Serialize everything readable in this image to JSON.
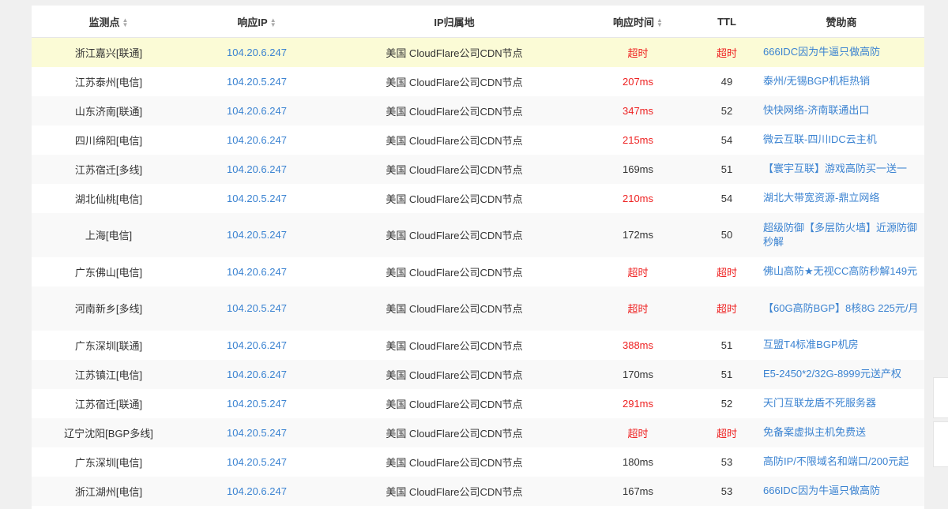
{
  "headers": {
    "location": "监测点",
    "ip": "响应IP",
    "geo": "IP归属地",
    "time": "响应时间",
    "ttl": "TTL",
    "sponsor": "赞助商"
  },
  "sort_icon": "sort-arrows-icon",
  "colors": {
    "link": "#3b83d1",
    "timeout": "#ee2222",
    "highlight": "#fbfbd6"
  },
  "rows": [
    {
      "location": "浙江嘉兴[联通]",
      "ip": "104.20.6.247",
      "geo": "美国 CloudFlare公司CDN节点",
      "time": "超时",
      "time_status": "red",
      "ttl": "超时",
      "ttl_status": "red",
      "sponsor": "666IDC因为牛逼只做高防",
      "highlight": true
    },
    {
      "location": "江苏泰州[电信]",
      "ip": "104.20.5.247",
      "geo": "美国 CloudFlare公司CDN节点",
      "time": "207ms",
      "time_status": "red",
      "ttl": "49",
      "ttl_status": "normal",
      "sponsor": "泰州/无锡BGP机柜热销"
    },
    {
      "location": "山东济南[联通]",
      "ip": "104.20.6.247",
      "geo": "美国 CloudFlare公司CDN节点",
      "time": "347ms",
      "time_status": "red",
      "ttl": "52",
      "ttl_status": "normal",
      "sponsor": "快快网络-济南联通出口"
    },
    {
      "location": "四川绵阳[电信]",
      "ip": "104.20.6.247",
      "geo": "美国 CloudFlare公司CDN节点",
      "time": "215ms",
      "time_status": "red",
      "ttl": "54",
      "ttl_status": "normal",
      "sponsor": "微云互联-四川IDC云主机"
    },
    {
      "location": "江苏宿迁[多线]",
      "ip": "104.20.6.247",
      "geo": "美国 CloudFlare公司CDN节点",
      "time": "169ms",
      "time_status": "normal",
      "ttl": "51",
      "ttl_status": "normal",
      "sponsor": "【寰宇互联】游戏高防买一送一"
    },
    {
      "location": "湖北仙桃[电信]",
      "ip": "104.20.5.247",
      "geo": "美国 CloudFlare公司CDN节点",
      "time": "210ms",
      "time_status": "red",
      "ttl": "54",
      "ttl_status": "normal",
      "sponsor": "湖北大带宽资源-鼎立网络"
    },
    {
      "location": "上海[电信]",
      "ip": "104.20.5.247",
      "geo": "美国 CloudFlare公司CDN节点",
      "time": "172ms",
      "time_status": "normal",
      "ttl": "50",
      "ttl_status": "normal",
      "sponsor": "超级防御【多层防火墙】近源防御秒解",
      "tall": true
    },
    {
      "location": "广东佛山[电信]",
      "ip": "104.20.6.247",
      "geo": "美国 CloudFlare公司CDN节点",
      "time": "超时",
      "time_status": "red",
      "ttl": "超时",
      "ttl_status": "red",
      "sponsor": "佛山高防★无视CC高防秒解149元"
    },
    {
      "location": "河南新乡[多线]",
      "ip": "104.20.5.247",
      "geo": "美国 CloudFlare公司CDN节点",
      "time": "超时",
      "time_status": "red",
      "ttl": "超时",
      "ttl_status": "red",
      "sponsor": "【60G高防BGP】8核8G 225元/月",
      "tall": true
    },
    {
      "location": "广东深圳[联通]",
      "ip": "104.20.6.247",
      "geo": "美国 CloudFlare公司CDN节点",
      "time": "388ms",
      "time_status": "red",
      "ttl": "51",
      "ttl_status": "normal",
      "sponsor": "互盟T4标准BGP机房"
    },
    {
      "location": "江苏镇江[电信]",
      "ip": "104.20.6.247",
      "geo": "美国 CloudFlare公司CDN节点",
      "time": "170ms",
      "time_status": "normal",
      "ttl": "51",
      "ttl_status": "normal",
      "sponsor": "E5-2450*2/32G-8999元送产权"
    },
    {
      "location": "江苏宿迁[联通]",
      "ip": "104.20.5.247",
      "geo": "美国 CloudFlare公司CDN节点",
      "time": "291ms",
      "time_status": "red",
      "ttl": "52",
      "ttl_status": "normal",
      "sponsor": "天门互联龙盾不死服务器"
    },
    {
      "location": "辽宁沈阳[BGP多线]",
      "ip": "104.20.5.247",
      "geo": "美国 CloudFlare公司CDN节点",
      "time": "超时",
      "time_status": "red",
      "ttl": "超时",
      "ttl_status": "red",
      "sponsor": "免备案虚拟主机免费送"
    },
    {
      "location": "广东深圳[电信]",
      "ip": "104.20.5.247",
      "geo": "美国 CloudFlare公司CDN节点",
      "time": "180ms",
      "time_status": "normal",
      "ttl": "53",
      "ttl_status": "normal",
      "sponsor": "高防IP/不限域名和端口/200元起"
    },
    {
      "location": "浙江湖州[电信]",
      "ip": "104.20.6.247",
      "geo": "美国 CloudFlare公司CDN节点",
      "time": "167ms",
      "time_status": "normal",
      "ttl": "53",
      "ttl_status": "normal",
      "sponsor": "666IDC因为牛逼只做高防"
    }
  ]
}
